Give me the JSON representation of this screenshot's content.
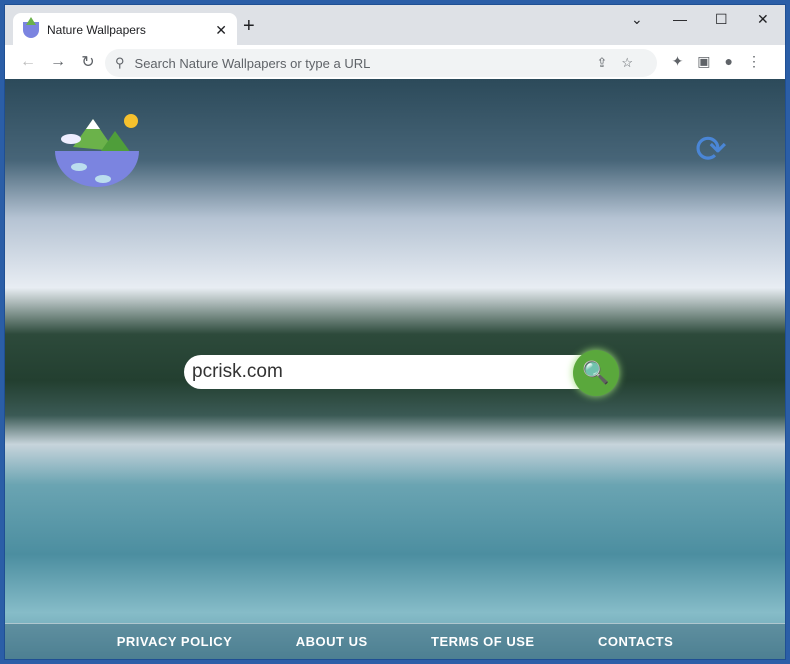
{
  "tab": {
    "title": "Nature Wallpapers",
    "close": "✕",
    "new_tab": "+"
  },
  "window": {
    "minimize": "⌄",
    "maximize": "☐",
    "close": "✕"
  },
  "nav": {
    "back": "←",
    "forward": "→",
    "reload": "↻"
  },
  "omnibox": {
    "placeholder": "Search Nature Wallpapers or type a URL",
    "icons": "⇪☆"
  },
  "toolbar_icons": "✦▣●⋮",
  "page": {
    "search_value": "pcrisk.com",
    "search_icon": "🔍",
    "refresh_icon": "⟳"
  },
  "footer": {
    "links": [
      "PRIVACY POLICY",
      "ABOUT US",
      "TERMS OF USE",
      "CONTACTS"
    ]
  }
}
